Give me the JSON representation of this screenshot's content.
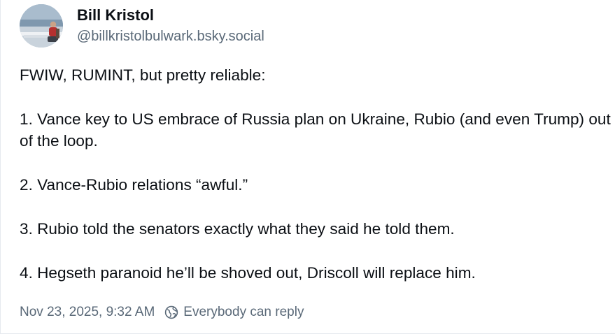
{
  "post": {
    "author": {
      "display_name": "Bill Kristol",
      "handle": "@billkristolbulwark.bsky.social",
      "avatar": "profile-photo"
    },
    "paragraphs": [
      "FWIW, RUMINT, but pretty reliable:",
      "1. Vance key to US embrace of Russia plan on Ukraine, Rubio (and even Trump) out of the loop.",
      "2. Vance-Rubio relations “awful.”",
      "3. Rubio told the senators exactly what they said he told them.",
      "4. Hegseth paranoid he’ll be shoved out, Driscoll will replace him."
    ],
    "timestamp": "Nov 23, 2025, 9:32 AM",
    "reply_setting": "Everybody can reply",
    "reply_icon": "earth-globe-icon"
  },
  "colors": {
    "text": "#0b0f14",
    "muted": "#5a6978",
    "border": "#e6e9ee"
  }
}
